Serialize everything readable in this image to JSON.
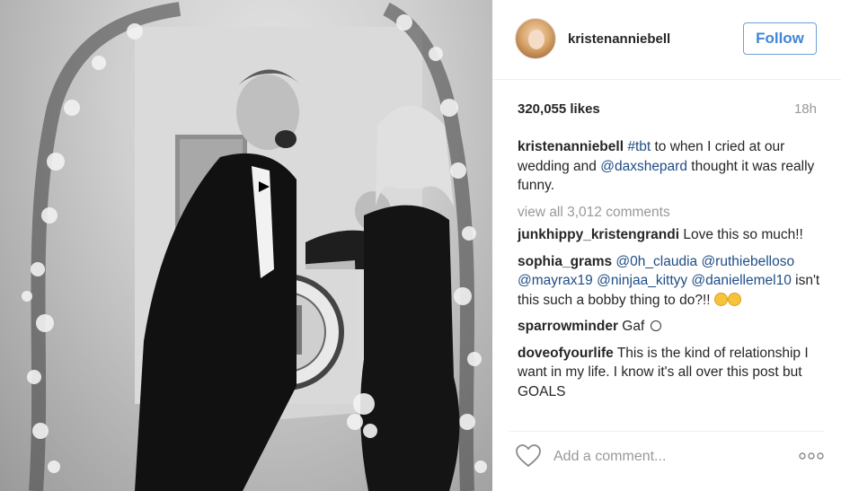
{
  "post": {
    "username": "kristenanniebell",
    "follow_label": "Follow",
    "likes": "320,055 likes",
    "time": "18h"
  },
  "caption": {
    "username": "kristenanniebell",
    "hashtag": "#tbt",
    "text1": " to when I cried at our wedding and ",
    "mention": "@daxshepard",
    "text2": " thought it was really funny."
  },
  "view_all": "view all 3,012 comments",
  "comments": [
    {
      "username": "junkhippy_kristengrandi",
      "text": " Love this so much!!"
    },
    {
      "username": "sophia_grams",
      "mentions": "@0h_claudia @ruthiebelloso @mayrax19 @ninjaa_kittyy @daniellemel10",
      "text": " isn't this such a bobby thing to do?!! "
    },
    {
      "username": "sparrowminder",
      "text": " Gaf "
    },
    {
      "username": "doveofyourlife",
      "text": " This is the kind of relationship I want in my life. I know it's all over this post but GOALS"
    }
  ],
  "footer": {
    "placeholder": "Add a comment..."
  },
  "icons": {
    "heart": "heart-icon",
    "more": "more-options-icon",
    "laugh": "tears-of-joy-emoji-icon",
    "smile": "smiley-icon"
  },
  "colors": {
    "follow": "#3f86d8",
    "mention": "#1f4d85",
    "muted": "#999999"
  }
}
